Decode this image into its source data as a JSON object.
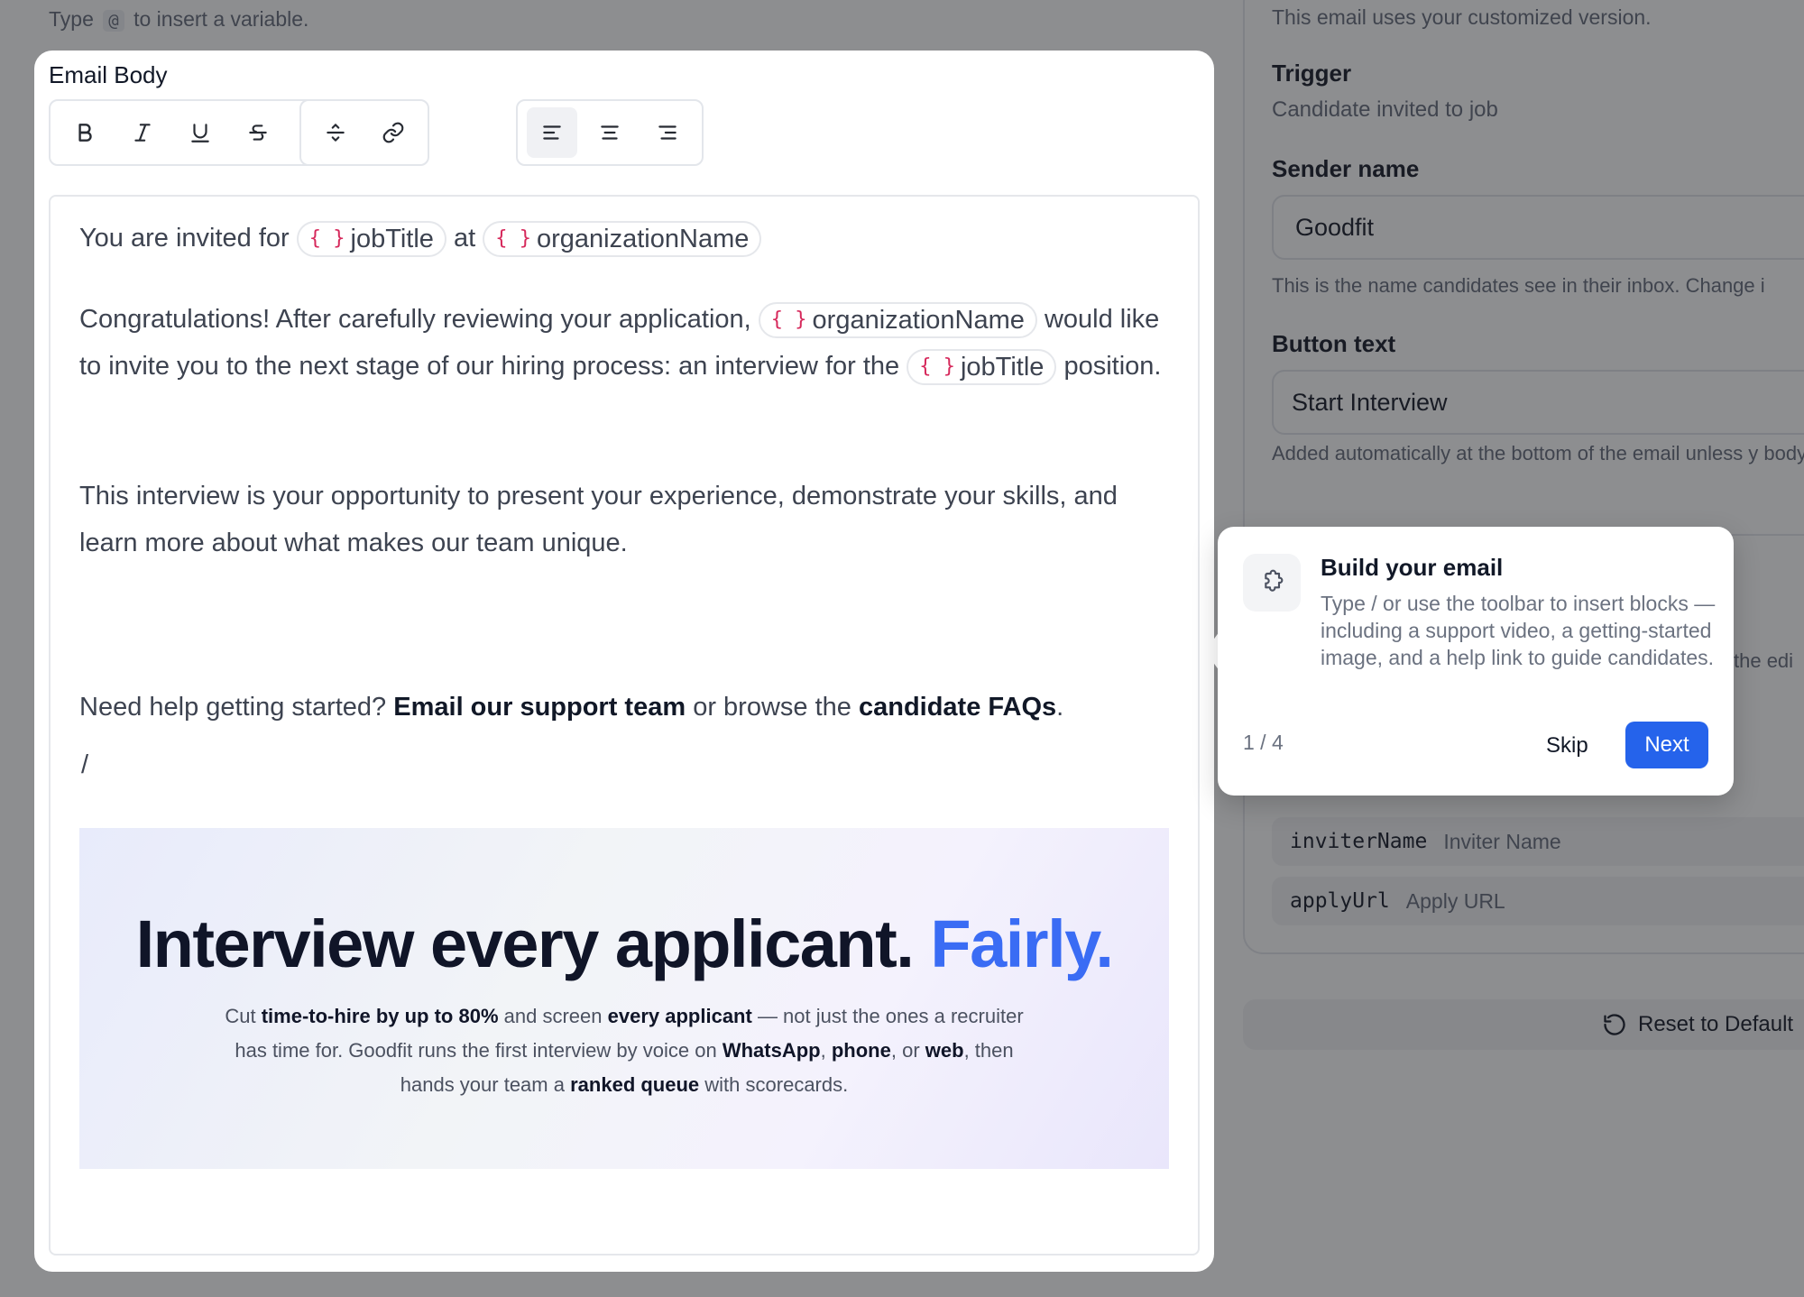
{
  "top_hint": {
    "before": "Type",
    "key": "@",
    "after": "to insert a variable."
  },
  "email_body": {
    "title": "Email Body",
    "toolbar": {
      "bold": "bold-icon",
      "italic": "italic-icon",
      "underline": "underline-icon",
      "strikethrough": "strikethrough-icon",
      "clear": "eraser-icon",
      "divider": "divider-icon",
      "link": "link-icon",
      "align_left": "align-left-icon",
      "align_center": "align-center-icon",
      "align_right": "align-right-icon",
      "active": "align_left"
    },
    "line1": {
      "text1": "You are invited for",
      "var1": "jobTitle",
      "text2": "at",
      "var2": "organizationName"
    },
    "para2": {
      "text1": "Congratulations! After carefully reviewing your application,",
      "var1": "organizationName",
      "text2": "would like to invite you to the next stage of our hiring process: an interview for the",
      "var2": "jobTitle",
      "text3": "position."
    },
    "para3": "This interview is your opportunity to present your experience, demonstrate your skills, and learn more about what makes our team unique.",
    "help_line": {
      "text1": "Need help getting started?",
      "link1": "Email our support team",
      "text2": "or browse the",
      "link2": "candidate FAQs",
      "text3": "."
    },
    "slash": "/",
    "var_brace": "{ }",
    "banner": {
      "title_main": "Interview every applicant.",
      "title_accent": "Fairly.",
      "c1": "Cut",
      "b1": "time-to-hire by up to 80%",
      "c2": "and screen",
      "b2": "every applicant",
      "c3": "— not just the ones a recruiter has time for. Goodfit runs the first interview by voice on",
      "b3": "WhatsApp",
      "c4": ",",
      "b4": "phone",
      "c5": ", or",
      "b5": "web",
      "c6": ", then hands your team a",
      "b6": "ranked queue",
      "c7": "with scorecards."
    }
  },
  "settings": {
    "note": "This email uses your customized version.",
    "trigger_label": "Trigger",
    "trigger_value": "Candidate invited to job",
    "sender_label": "Sender name",
    "sender_value": "Goodfit",
    "sender_help": "This is the name candidates see in their inbox. Change i",
    "button_label": "Button text",
    "button_value": "Start Interview",
    "button_help": "Added automatically at the bottom of the email unless y body.",
    "peek_text": "the edi",
    "variables": [
      {
        "key": "inviterName",
        "label": "Inviter Name"
      },
      {
        "key": "applyUrl",
        "label": "Apply URL"
      }
    ],
    "reset_label": "Reset to Default"
  },
  "tour": {
    "title": "Build your email",
    "body": "Type / or use the toolbar to insert blocks — including a support video, a getting-started image, and a help link to guide candidates.",
    "step": "1 / 4",
    "skip": "Skip",
    "next": "Next",
    "icon": "puzzle-icon"
  },
  "colors": {
    "accent": "#2563eb",
    "variable_brace": "#d6285b",
    "banner_accent": "#3a6cf4"
  }
}
